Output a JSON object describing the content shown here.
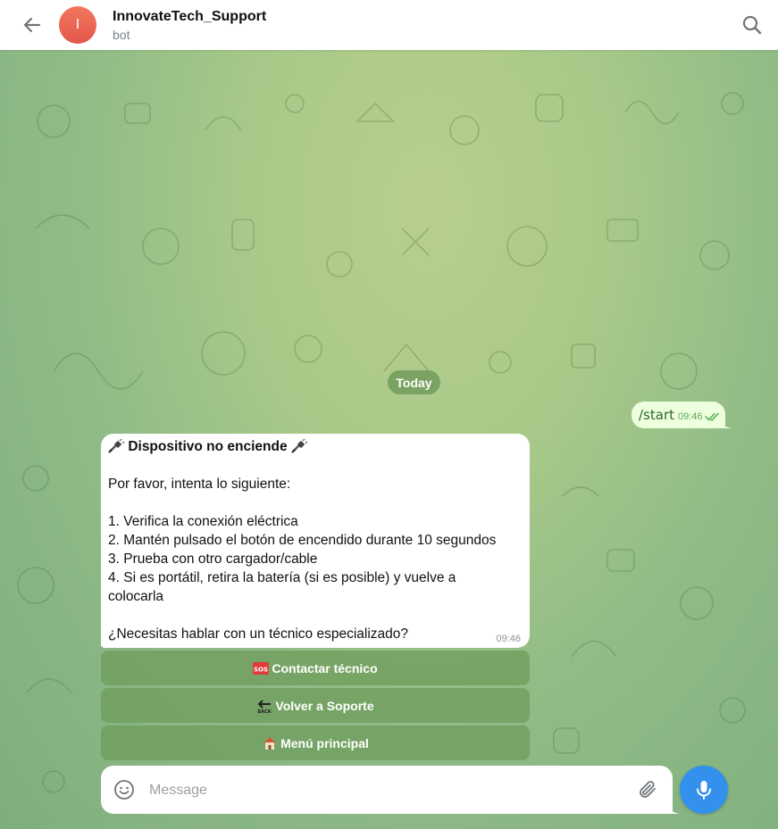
{
  "header": {
    "avatar_letter": "I",
    "title": "InnovateTech_Support",
    "subtitle": "bot"
  },
  "chat": {
    "date_label": "Today",
    "outgoing": {
      "text": "/start",
      "time": "09:46",
      "status": "read"
    },
    "incoming": {
      "heading": "Dispositivo no enciende",
      "heading_icon": "electric-plug-icon",
      "lines": [
        "Por favor, intenta lo siguiente:",
        "1. Verifica la conexión eléctrica",
        "2. Mantén pulsado el botón de encendido durante 10 segundos",
        "3. Prueba con otro cargador/cable",
        "4. Si es portátil, retira la batería (si es posible) y vuelve a",
        "colocarla",
        "¿Necesitas hablar con un técnico especializado?"
      ],
      "time": "09:46"
    },
    "keyboard": [
      {
        "label": "Contactar técnico",
        "icon": "sos-icon"
      },
      {
        "label": "Volver a Soporte",
        "icon": "back-arrow-icon"
      },
      {
        "label": "Menú principal",
        "icon": "house-icon"
      }
    ]
  },
  "composer": {
    "placeholder": "Message"
  },
  "colors": {
    "accent": "#3390ec",
    "outgoing_bubble": "#eeffde",
    "keyboard_button": "#6e9b5a"
  }
}
